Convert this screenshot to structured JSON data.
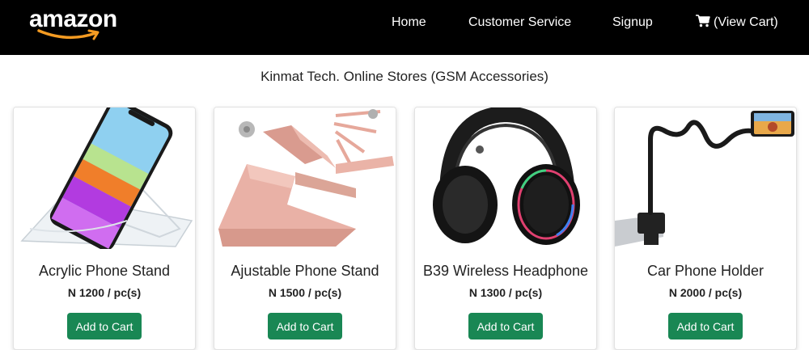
{
  "header": {
    "logo_text": "amazon",
    "nav": {
      "home": "Home",
      "customer_service": "Customer Service",
      "signup": "Signup",
      "view_cart": "(View Cart)"
    }
  },
  "store_title": "Kinmat Tech. Online Stores (GSM Accessories)",
  "products": [
    {
      "name": "Acrylic Phone Stand",
      "price": "N 1200 / pc(s)",
      "button": "Add to Cart",
      "image_icon": "acrylic-phone-stand-image"
    },
    {
      "name": "Ajustable Phone Stand",
      "price": "N 1500 / pc(s)",
      "button": "Add to Cart",
      "image_icon": "adjustable-phone-stand-image"
    },
    {
      "name": "B39 Wireless Headphone",
      "price": "N 1300 / pc(s)",
      "button": "Add to Cart",
      "image_icon": "wireless-headphone-image"
    },
    {
      "name": "Car Phone Holder",
      "price": "N 2000 / pc(s)",
      "button": "Add to Cart",
      "image_icon": "car-phone-holder-image"
    }
  ],
  "colors": {
    "navbar_bg": "#000000",
    "brand_accent": "#f49b22",
    "button_bg": "#198754"
  }
}
